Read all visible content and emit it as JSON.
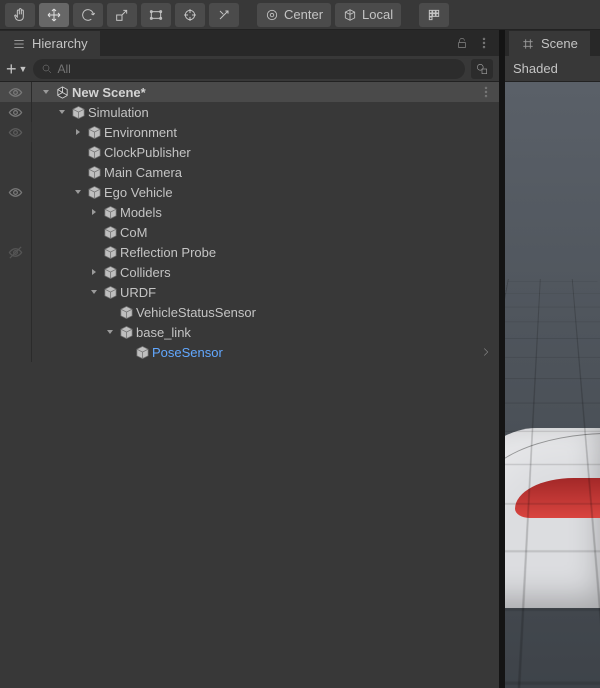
{
  "toolbar": {
    "pivot_center": "Center",
    "pivot_local": "Local"
  },
  "panels": {
    "hierarchy_title": "Hierarchy",
    "scene_title": "Scene",
    "scene_shading": "Shaded"
  },
  "search": {
    "placeholder": "All"
  },
  "tree": [
    {
      "id": "scene",
      "depth": 0,
      "label": "New Scene*",
      "icon": "unity",
      "expanded": true,
      "hasChildren": true,
      "root": true,
      "vis": "eye"
    },
    {
      "id": "sim",
      "depth": 1,
      "label": "Simulation",
      "icon": "cube",
      "expanded": true,
      "hasChildren": true,
      "vis": "eye"
    },
    {
      "id": "env",
      "depth": 2,
      "label": "Environment",
      "icon": "cube",
      "expanded": false,
      "hasChildren": true,
      "vis": "fade"
    },
    {
      "id": "clock",
      "depth": 2,
      "label": "ClockPublisher",
      "icon": "cube",
      "expanded": false,
      "hasChildren": false,
      "vis": "none"
    },
    {
      "id": "cam",
      "depth": 2,
      "label": "Main Camera",
      "icon": "cube",
      "expanded": false,
      "hasChildren": false,
      "vis": "none"
    },
    {
      "id": "ego",
      "depth": 2,
      "label": "Ego Vehicle",
      "icon": "cube",
      "expanded": true,
      "hasChildren": true,
      "vis": "eye"
    },
    {
      "id": "models",
      "depth": 3,
      "label": "Models",
      "icon": "cube",
      "expanded": false,
      "hasChildren": true,
      "vis": "none"
    },
    {
      "id": "com",
      "depth": 3,
      "label": "CoM",
      "icon": "cube",
      "expanded": false,
      "hasChildren": false,
      "vis": "none"
    },
    {
      "id": "refl",
      "depth": 3,
      "label": "Reflection Probe",
      "icon": "cube",
      "expanded": false,
      "hasChildren": false,
      "vis": "hidden"
    },
    {
      "id": "coll",
      "depth": 3,
      "label": "Colliders",
      "icon": "cube",
      "expanded": false,
      "hasChildren": true,
      "vis": "none"
    },
    {
      "id": "urdf",
      "depth": 3,
      "label": "URDF",
      "icon": "cube",
      "expanded": true,
      "hasChildren": true,
      "vis": "none"
    },
    {
      "id": "vss",
      "depth": 4,
      "label": "VehicleStatusSensor",
      "icon": "cube",
      "expanded": false,
      "hasChildren": false,
      "vis": "none"
    },
    {
      "id": "base",
      "depth": 4,
      "label": "base_link",
      "icon": "cube",
      "expanded": true,
      "hasChildren": true,
      "vis": "none"
    },
    {
      "id": "pose",
      "depth": 5,
      "label": "PoseSensor",
      "icon": "cube",
      "expanded": false,
      "hasChildren": false,
      "selected": true,
      "vis": "none",
      "chevron": true
    }
  ],
  "colors": {
    "selection": "#62a8ff"
  }
}
